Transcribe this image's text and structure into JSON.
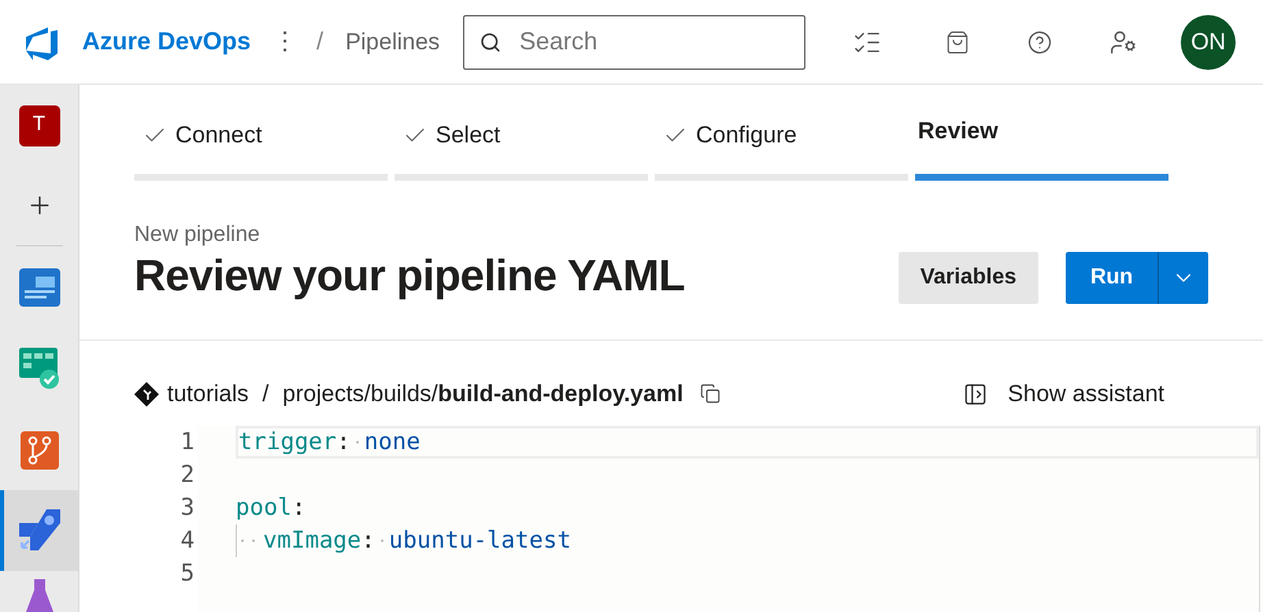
{
  "header": {
    "brand": "Azure DevOps",
    "more": "⋮",
    "separator": "/",
    "breadcrumb": "Pipelines",
    "search": {
      "placeholder": "Search"
    },
    "avatar": "ON"
  },
  "sidebar": {
    "items": [
      {
        "kind": "project",
        "label": "T",
        "color": "#a80000",
        "selected": false
      },
      {
        "kind": "add",
        "selected": false
      },
      {
        "kind": "overview",
        "selected": false
      },
      {
        "kind": "boards",
        "selected": false
      },
      {
        "kind": "repos",
        "selected": false
      },
      {
        "kind": "pipelines",
        "selected": true
      },
      {
        "kind": "testplans",
        "selected": false
      }
    ]
  },
  "steps": [
    {
      "label": "Connect",
      "done": true,
      "selected": false
    },
    {
      "label": "Select",
      "done": true,
      "selected": false
    },
    {
      "label": "Configure",
      "done": true,
      "selected": false
    },
    {
      "label": "Review",
      "done": false,
      "selected": true
    }
  ],
  "page": {
    "subtitle": "New pipeline",
    "title": "Review your pipeline YAML",
    "buttons": [
      {
        "kind": "secondary",
        "label": "Variables"
      },
      {
        "kind": "primary",
        "label": "Run"
      }
    ]
  },
  "file": {
    "repo": "tutorials",
    "separator": "/",
    "path": "projects/builds/",
    "filename": "build-and-deploy.yaml",
    "assistant": "Show assistant"
  },
  "editor": {
    "lines": [
      {
        "number": "1",
        "current": true,
        "indented": false,
        "tokens": [
          {
            "kind": "key",
            "text": "trigger"
          },
          {
            "kind": "punct",
            "text": ":"
          },
          {
            "kind": "value",
            "text": "none"
          }
        ]
      },
      {
        "number": "2",
        "current": false,
        "indented": false
      },
      {
        "number": "3",
        "current": false,
        "indented": false,
        "tokens": [
          {
            "kind": "key",
            "text": "pool"
          },
          {
            "kind": "punct",
            "text": ":"
          }
        ]
      },
      {
        "number": "4",
        "current": false,
        "indented": true,
        "tokens": [
          {
            "kind": "key",
            "text": "vmImage"
          },
          {
            "kind": "punct",
            "text": ":"
          },
          {
            "kind": "value",
            "text": "ubuntu-latest"
          }
        ]
      },
      {
        "number": "5",
        "current": false,
        "indented": false
      }
    ]
  }
}
